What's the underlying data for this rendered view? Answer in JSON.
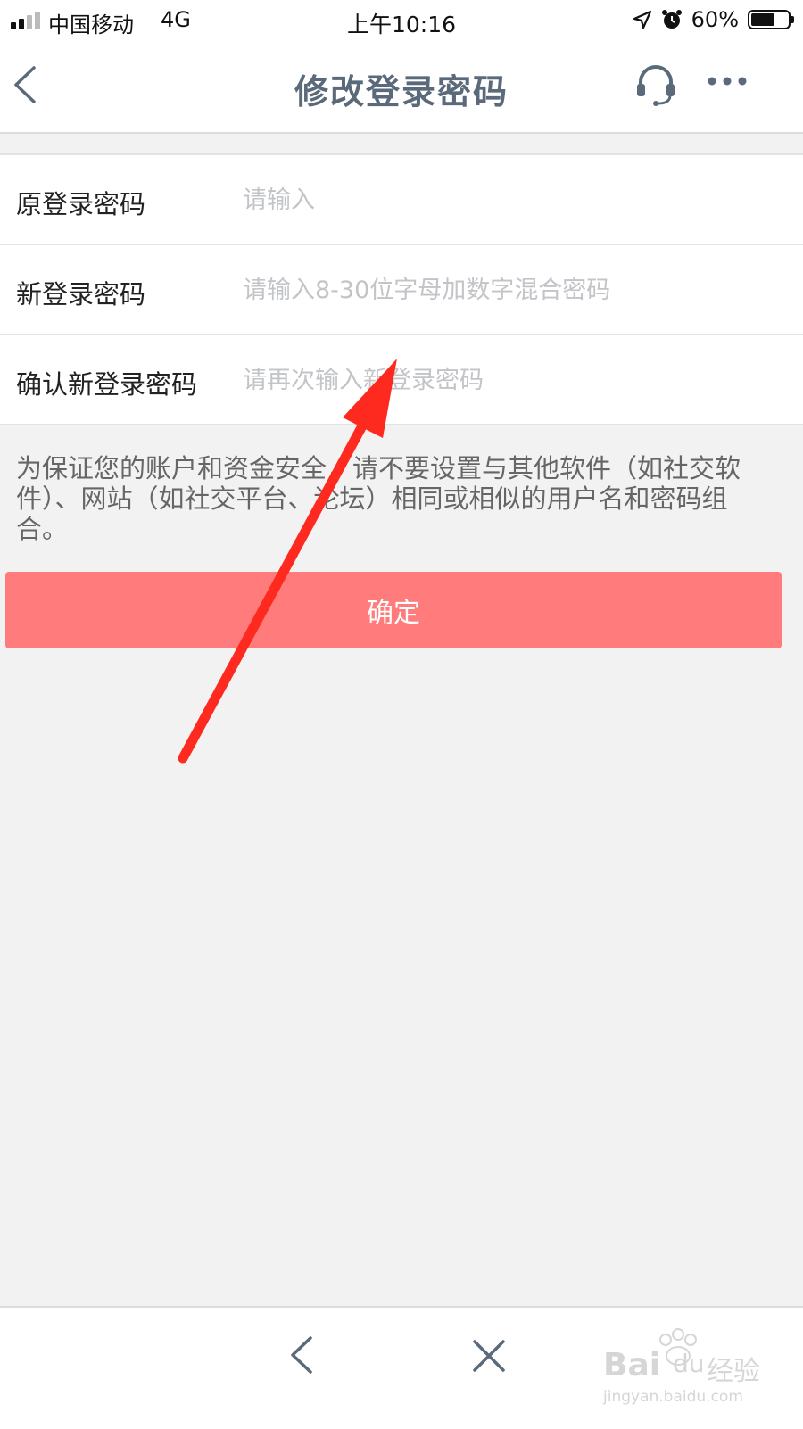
{
  "status_bar": {
    "carrier": "中国移动",
    "network": "4G",
    "time": "上午10:16",
    "battery": "60%",
    "battery_level": 0.6
  },
  "nav": {
    "title": "修改登录密码",
    "icons": [
      "back-chevron-icon",
      "headset-icon",
      "more-icon"
    ]
  },
  "form": {
    "rows": [
      {
        "label": "原登录密码",
        "placeholder": "请输入",
        "value": ""
      },
      {
        "label": "新登录密码",
        "placeholder": "请输入8-30位字母加数字混合密码",
        "value": ""
      },
      {
        "label": "确认新登录密码",
        "placeholder": "请再次输入新登录密码",
        "value": ""
      }
    ]
  },
  "notice": "为保证您的账户和资金安全，请不要设置与其他软件（如社交软件）、网站（如社交平台、论坛）相同或相似的用户名和密码组合。",
  "confirm_label": "确定",
  "watermark": {
    "brand": "Bai",
    "brand_du": "du",
    "jingyan": "经验",
    "url": "jingyan.baidu.com"
  },
  "colors": {
    "button": "#ff7b7c",
    "title": "#5a6a7a",
    "arrow": "#ff2a1f",
    "placeholder": "#c2c4c8",
    "background": "#f2f2f3"
  }
}
